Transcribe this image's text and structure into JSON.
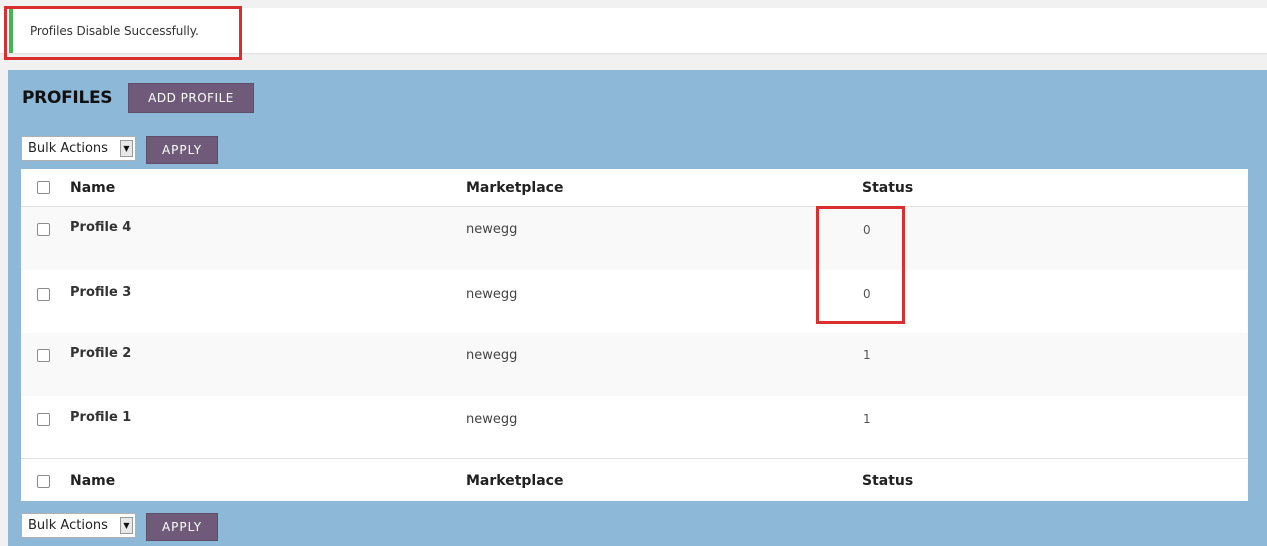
{
  "notice": {
    "message": "Profiles Disable Successfully."
  },
  "header": {
    "title": "PROFILES",
    "add_button": "ADD PROFILE"
  },
  "bulk_top": {
    "selected": "Bulk Actions",
    "apply": "APPLY"
  },
  "bulk_bottom": {
    "selected": "Bulk Actions",
    "apply": "APPLY"
  },
  "columns": {
    "name": "Name",
    "marketplace": "Marketplace",
    "status": "Status"
  },
  "rows": [
    {
      "name": "Profile 4",
      "marketplace": "newegg",
      "status": "0"
    },
    {
      "name": "Profile 3",
      "marketplace": "newegg",
      "status": "0"
    },
    {
      "name": "Profile 2",
      "marketplace": "newegg",
      "status": "1"
    },
    {
      "name": "Profile 1",
      "marketplace": "newegg",
      "status": "1"
    }
  ],
  "colors": {
    "panel": "#8db8d8",
    "button": "#6f5b79",
    "highlight": "#d9302f",
    "notice_border": "#46b450"
  }
}
